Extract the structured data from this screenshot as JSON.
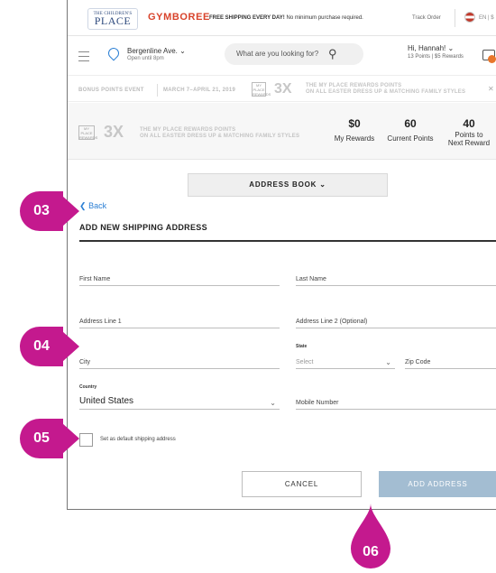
{
  "topbar": {
    "tcp_logo_small": "THE CHILDREN'S",
    "tcp_logo_big": "PLACE",
    "gymboree_logo": "GYMBOREE",
    "free_shipping_bold": "FREE SHIPPING EVERY DAY!",
    "free_shipping_rest": " No minimum purchase required.",
    "track_order": "Track Order",
    "lang": "EN | $"
  },
  "header": {
    "store_name": "Bergenline Ave.",
    "store_hours": "Open until 8pm",
    "search_placeholder": "What are you looking for?",
    "greeting": "Hi, Hannah!",
    "points_summary": "13 Points  |  $5 Rewards"
  },
  "promo": {
    "bonus": "BONUS POINTS EVENT",
    "dates": "MARCH 7–APRIL 21, 2019",
    "multiplier": "3X",
    "text_line1": "THE MY PLACE REWARDS POINTS",
    "text_line2": "ON ALL EASTER DRESS UP & MATCHING FAMILY STYLES",
    "badge_text": "MY PLACE REWARDS"
  },
  "rewards": {
    "my_rewards_value": "$0",
    "my_rewards_label": "My Rewards",
    "current_points_value": "60",
    "current_points_label": "Current Points",
    "next_reward_value": "40",
    "next_reward_label_1": "Points to",
    "next_reward_label_2": "Next Reward"
  },
  "form": {
    "address_book_label": "ADDRESS BOOK",
    "back_label": "Back",
    "title": "ADD NEW SHIPPING ADDRESS",
    "first_name": "First Name",
    "last_name": "Last Name",
    "address_line1": "Address Line 1",
    "address_line2": "Address Line 2 (Optional)",
    "city": "City",
    "state_caption": "State",
    "state_value": "Select",
    "zip": "Zip Code",
    "country_caption": "Country",
    "country_value": "United States",
    "mobile": "Mobile Number",
    "default_checkbox_label": "Set as default shipping address",
    "cancel_label": "CANCEL",
    "add_address_label": "ADD ADDRESS"
  },
  "callouts": {
    "c03": "03",
    "c04": "04",
    "c05": "05",
    "c06": "06"
  },
  "colors": {
    "callout": "#c4198e",
    "link": "#2b7fd4",
    "add_address_button": "#a3bdd2"
  }
}
